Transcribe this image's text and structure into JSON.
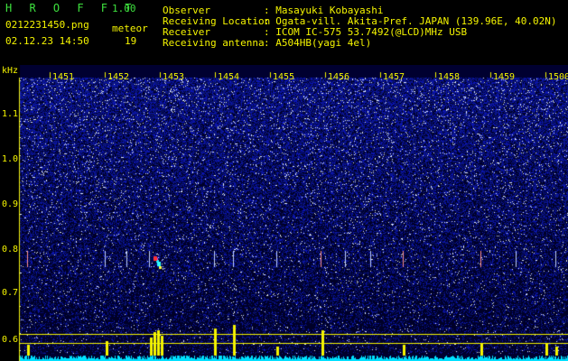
{
  "header": {
    "brand": "H R O F F T",
    "version": "1.00",
    "filename": "0212231450.png",
    "timestamp": "02.12.23 14:50",
    "meteor_label": "meteor",
    "meteor_count": "19",
    "fields": [
      {
        "label": "Observer",
        "value": ": Masayuki Kobayashi"
      },
      {
        "label": "Receiving Location",
        "value": ": Ogata-vill. Akita-Pref. JAPAN (139.96E, 40.02N)"
      },
      {
        "label": "Receiver",
        "value": ": ICOM IC-575 53.7492(@LCD)MHz USB"
      },
      {
        "label": "Receiving antenna",
        "value": ": A504HB(yagi 4el)"
      }
    ]
  },
  "spectrogram": {
    "y_unit": "kHz",
    "y_ticks": [
      "1.1",
      "1.0",
      "0.9",
      "0.8",
      "0.7",
      "0.6"
    ],
    "x_ticks": [
      "1451",
      "1452",
      "1453",
      "1454",
      "1455",
      "1456",
      "1457",
      "1458",
      "1459",
      "1500"
    ],
    "colors": {
      "background": "#000040",
      "noise": "#2030c8",
      "signal": "#ffff00",
      "baseline": "#00e0ff"
    }
  }
}
